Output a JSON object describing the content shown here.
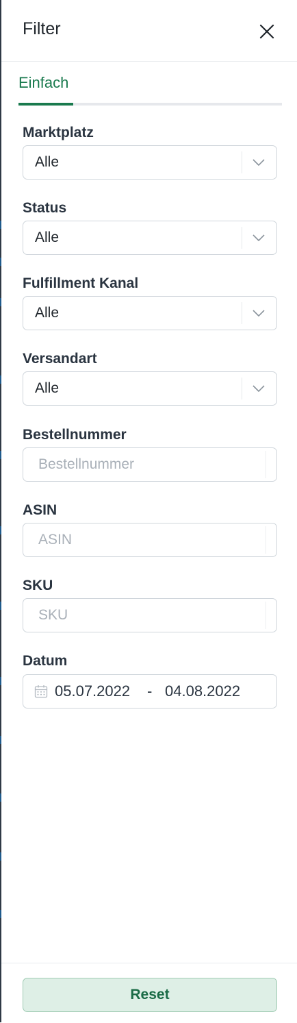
{
  "header": {
    "title": "Filter",
    "close_icon": "close-icon"
  },
  "tabs": [
    {
      "label": "Einfach",
      "active": true
    }
  ],
  "fields": {
    "marktplatz": {
      "label": "Marktplatz",
      "value": "Alle"
    },
    "status": {
      "label": "Status",
      "value": "Alle"
    },
    "fulfillment": {
      "label": "Fulfillment Kanal",
      "value": "Alle"
    },
    "versandart": {
      "label": "Versandart",
      "value": "Alle"
    },
    "bestellnummer": {
      "label": "Bestellnummer",
      "value": "",
      "placeholder": "Bestellnummer"
    },
    "asin": {
      "label": "ASIN",
      "value": "",
      "placeholder": "ASIN"
    },
    "sku": {
      "label": "SKU",
      "value": "",
      "placeholder": "SKU"
    },
    "datum": {
      "label": "Datum",
      "from": "05.07.2022",
      "separator": "-",
      "to": "04.08.2022",
      "icon": "calendar-icon"
    }
  },
  "footer": {
    "reset_label": "Reset"
  },
  "colors": {
    "accent": "#1a7a4e",
    "reset_bg": "#deefe6",
    "reset_border": "#9fcbb3",
    "text": "#2a3440",
    "placeholder": "#a9b0b8",
    "border": "#cfd5db"
  }
}
